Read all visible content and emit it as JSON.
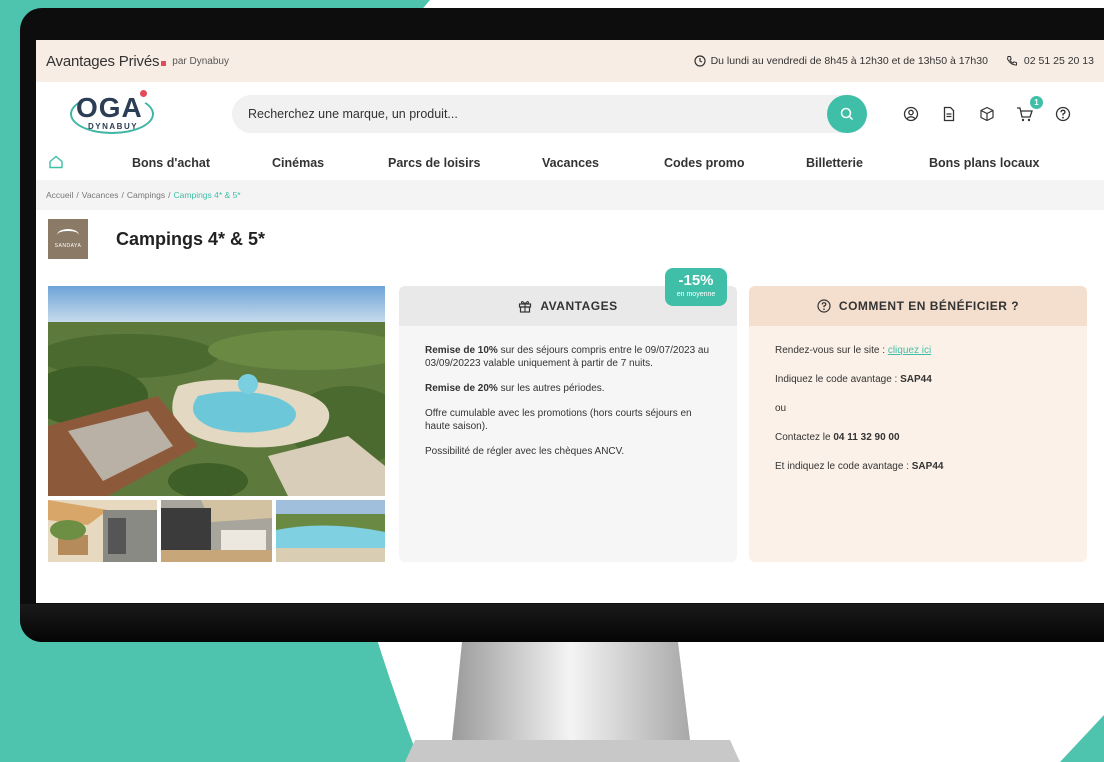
{
  "topbar": {
    "brand": "Avantages Privés",
    "brand_sub": "par Dynabuy",
    "hours": "Du lundi au vendredi de 8h45 à 12h30 et de 13h50 à 17h30",
    "phone": "02 51 25 20 13"
  },
  "header": {
    "logo_main": "OGA",
    "logo_sub": "DYNABUY",
    "search_placeholder": "Recherchez une marque, un produit...",
    "cart_count": "1"
  },
  "nav": {
    "items": [
      "Bons d'achat",
      "Cinémas",
      "Parcs de loisirs",
      "Vacances",
      "Codes promo",
      "Billetterie",
      "Bons plans locaux"
    ]
  },
  "breadcrumb": {
    "items": [
      "Accueil",
      "Vacances",
      "Campings"
    ],
    "current": "Campings 4* & 5*"
  },
  "page": {
    "title": "Campings 4* & 5*",
    "brand_logo_text": "SANDAYA"
  },
  "advantages": {
    "heading": "AVANTAGES",
    "badge_pct": "-15%",
    "badge_sub": "en moyenne",
    "p1_strong": "Remise de 10%",
    "p1_rest": " sur des séjours compris entre le 09/07/2023 au 03/09/20223 valable uniquement à partir de 7 nuits.",
    "p2_strong": "Remise de 20%",
    "p2_rest": " sur les autres périodes.",
    "p3": "Offre cumulable avec les promotions (hors courts séjours en haute saison).",
    "p4": "Possibilité de régler avec les chèques ANCV."
  },
  "howto": {
    "heading": "COMMENT EN BÉNÉFICIER ?",
    "l1_text": "Rendez-vous sur le site : ",
    "l1_link": "cliquez ici",
    "l2_text": "Indiquez le code avantage : ",
    "l2_code": "SAP44",
    "l3": "ou",
    "l4_text": "Contactez le ",
    "l4_phone": "04 11 32 90 00",
    "l5_text": "Et indiquez le code avantage : ",
    "l5_code": "SAP44"
  },
  "colors": {
    "accent": "#3fbfa8",
    "topbar_bg": "#f8ede4",
    "teal_bg": "#4ec3ad"
  }
}
